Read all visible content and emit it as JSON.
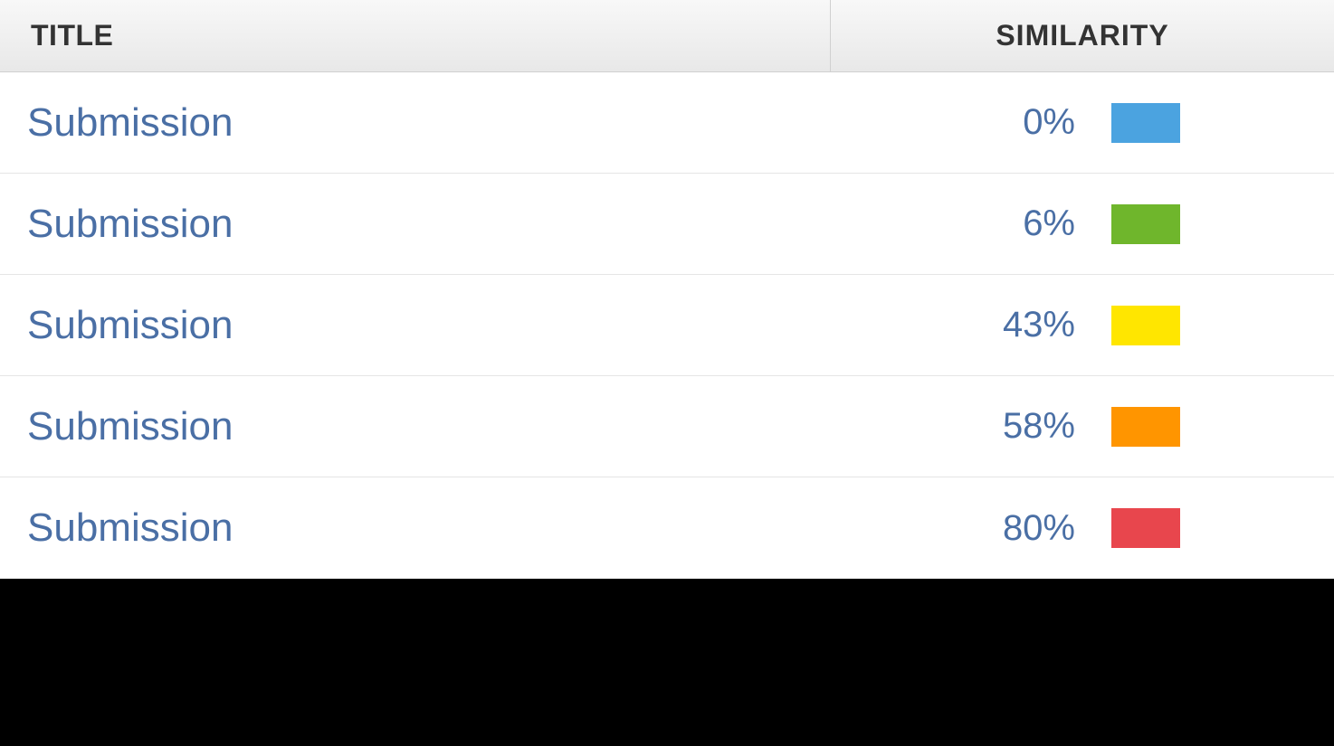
{
  "table": {
    "headers": {
      "title": "TITLE",
      "similarity": "SIMILARITY"
    },
    "rows": [
      {
        "title": "Submission",
        "similarity_percent": "0%",
        "swatch_color": "#4ba3e0"
      },
      {
        "title": "Submission",
        "similarity_percent": "6%",
        "swatch_color": "#6fb62c"
      },
      {
        "title": "Submission",
        "similarity_percent": "43%",
        "swatch_color": "#ffe600"
      },
      {
        "title": "Submission",
        "similarity_percent": "58%",
        "swatch_color": "#ff9500"
      },
      {
        "title": "Submission",
        "similarity_percent": "80%",
        "swatch_color": "#e8464d"
      }
    ]
  }
}
